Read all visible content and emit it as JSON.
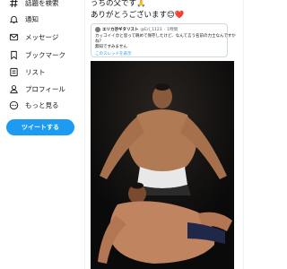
{
  "sidebar": {
    "items": [
      {
        "label": "話題を検索",
        "icon": "hashtag-icon"
      },
      {
        "label": "通知",
        "icon": "bell-icon"
      },
      {
        "label": "メッセージ",
        "icon": "mail-icon"
      },
      {
        "label": "ブックマーク",
        "icon": "bookmark-icon"
      },
      {
        "label": "リスト",
        "icon": "list-icon"
      },
      {
        "label": "プロフィール",
        "icon": "person-icon"
      },
      {
        "label": "もっと見る",
        "icon": "more-circle-icon"
      }
    ],
    "tweet_button": "ツイートする"
  },
  "tweet": {
    "line1": "うちの父です🙏",
    "line2": "ありがとうございます😊❤️"
  },
  "quote": {
    "name": "エリカ＠ギタリスト",
    "handle": "@Eri_1123",
    "time": "1時間",
    "body_line1": "カッコイイ😍と思って眺めて保存したけど、なんて言う名前の力士なんですか",
    "body_line2": "ね？",
    "body_line3": "無知ですみません",
    "link": "このスレッドを表示"
  },
  "colors": {
    "accent": "#1d9bf0",
    "text": "#0f1419",
    "muted": "#536471",
    "border": "#cfd9de"
  }
}
